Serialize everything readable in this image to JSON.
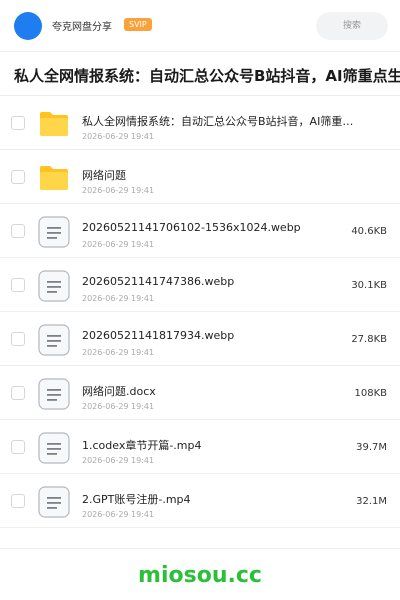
{
  "header": {
    "sharer_name": "夸克网盘分享",
    "badge": "SVIP",
    "search_placeholder": "搜索",
    "accent_color": "#1e7ef0"
  },
  "share": {
    "title": "私人全网情报系统：自动汇总公众号B站抖音，AI筛重点生成日报"
  },
  "files": [
    {
      "type": "folder",
      "icon": "folder-icon",
      "name": "私人全网情报系统：自动汇总公众号B站抖音，AI筛重点生成日报",
      "date": "2026-06-29 19:41",
      "size": ""
    },
    {
      "type": "folder",
      "icon": "folder-icon",
      "name": "网络问题",
      "date": "2026-06-29 19:41",
      "size": ""
    },
    {
      "type": "file",
      "icon": "document-icon",
      "name": "20260521141706102-1536x1024.webp",
      "date": "2026-06-29 19:41",
      "size": "40.6KB"
    },
    {
      "type": "file",
      "icon": "document-icon",
      "name": "20260521141747386.webp",
      "date": "2026-06-29 19:41",
      "size": "30.1KB"
    },
    {
      "type": "file",
      "icon": "document-icon",
      "name": "20260521141817934.webp",
      "date": "2026-06-29 19:41",
      "size": "27.8KB"
    },
    {
      "type": "file",
      "icon": "document-icon",
      "name": "网络问题.docx",
      "date": "2026-06-29 19:41",
      "size": "108KB"
    },
    {
      "type": "file",
      "icon": "document-icon",
      "name": "1.codex章节开篇-.mp4",
      "date": "2026-06-29 19:41",
      "size": "39.7M"
    },
    {
      "type": "file",
      "icon": "document-icon",
      "name": "2.GPT账号注册-.mp4",
      "date": "2026-06-29 19:41",
      "size": "32.1M"
    }
  ],
  "footer": {
    "watermark": "miosou.cc",
    "watermark_color": "#2bbf3a"
  }
}
